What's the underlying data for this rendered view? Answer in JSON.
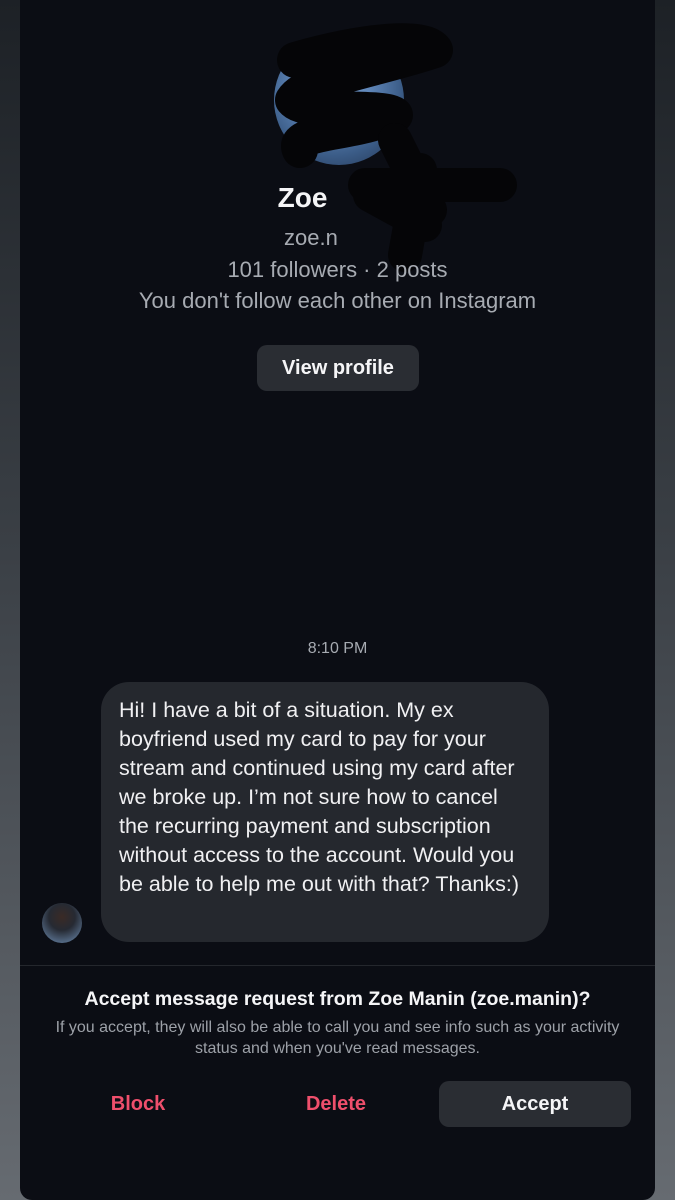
{
  "profile": {
    "name": "Zoe",
    "username": "zoe.n",
    "stats": "101 followers · 2 posts",
    "follow_status": "You don't follow each other on Instagram",
    "view_profile_label": "View profile"
  },
  "thread": {
    "timestamp": "8:10 PM",
    "message": "Hi! I have a bit of a situation. My ex boyfriend used my card to pay for your stream and continued using my card after we broke up. I’m not sure how to cancel the recurring payment and subscription without access to the account. Would you be able to help me out with that? Thanks:)"
  },
  "request": {
    "title": "Accept message request from Zoe Manin (zoe.manin)?",
    "description": "If you accept, they will also be able to call you and see info such as your activity status and when you've read messages.",
    "block_label": "Block",
    "delete_label": "Delete",
    "accept_label": "Accept"
  },
  "colors": {
    "background": "#0b0d14",
    "bubble": "#25282e",
    "button": "#2a2d33",
    "danger": "#ef4f6c",
    "muted_text": "#a7abb2"
  },
  "icons": {
    "profile_avatar": "profile-avatar-image",
    "sender_avatar": "sender-avatar-image",
    "redaction": "redaction-scribble"
  }
}
